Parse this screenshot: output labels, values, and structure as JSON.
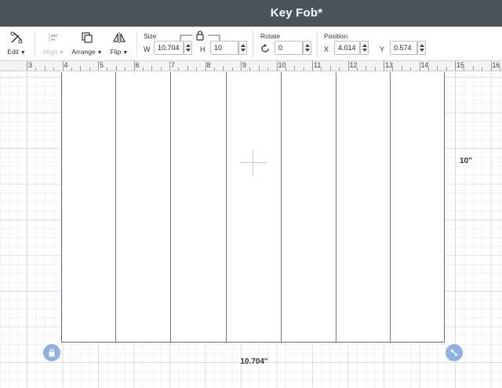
{
  "window": {
    "title": "Key Fob*"
  },
  "toolbar": {
    "edit_label": "Edit",
    "align_label": "Align",
    "arrange_label": "Arrange",
    "flip_label": "Flip",
    "size": {
      "label": "Size",
      "w_label": "W",
      "w_value": "10.704",
      "h_label": "H",
      "h_value": "10",
      "locked": true
    },
    "rotate": {
      "label": "Rotate",
      "value": "0"
    },
    "position": {
      "label": "Position",
      "x_label": "X",
      "x_value": "4.014",
      "y_label": "Y",
      "y_value": "0.574"
    }
  },
  "ruler": {
    "units": "in",
    "numbers": [
      "3",
      "4",
      "5",
      "6",
      "7",
      "8",
      "9",
      "10",
      "11",
      "12",
      "13",
      "14",
      "15",
      "16"
    ]
  },
  "canvas": {
    "width_dimension": "10.704\"",
    "height_dimension": "10\"",
    "panel_count": 7
  },
  "colors": {
    "titlebar": "#4a5459",
    "handle": "#8fb2e0",
    "shape_border": "#5b6b8a"
  }
}
